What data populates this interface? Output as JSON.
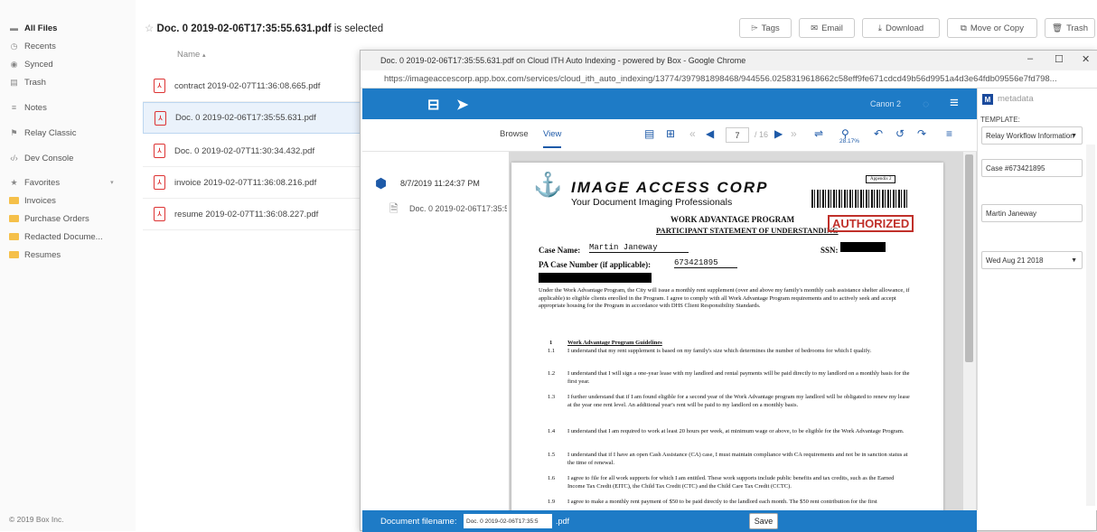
{
  "sidebar": {
    "items": [
      {
        "label": "All Files",
        "icon": "folder-icon"
      },
      {
        "label": "Recents",
        "icon": "clock-icon"
      },
      {
        "label": "Synced",
        "icon": "sync-icon"
      },
      {
        "label": "Trash",
        "icon": "trash-icon"
      },
      {
        "label": "Notes",
        "icon": "notes-icon"
      },
      {
        "label": "Relay Classic",
        "icon": "relay-icon"
      },
      {
        "label": "Dev Console",
        "icon": "code-icon"
      },
      {
        "label": "Favorites",
        "icon": "star-icon"
      },
      {
        "label": "Invoices",
        "icon": "folder-icon"
      },
      {
        "label": "Purchase Orders",
        "icon": "folder-icon"
      },
      {
        "label": "Redacted Docume...",
        "icon": "folder-icon"
      },
      {
        "label": "Resumes",
        "icon": "folder-icon"
      }
    ],
    "copyright": "© 2019 Box Inc."
  },
  "header": {
    "selected_name": "Doc. 0 2019-02-06T17:35:55.631.pdf",
    "selected_suffix": " is selected",
    "buttons": {
      "tags": "Tags",
      "email": "Email",
      "download": "Download",
      "move_copy": "Move or Copy",
      "trash": "Trash"
    }
  },
  "filelist": {
    "column_name": "Name",
    "files": [
      "contract 2019-02-07T11:36:08.665.pdf",
      "Doc. 0 2019-02-06T17:35:55.631.pdf",
      "Doc. 0 2019-02-07T11:30:34.432.pdf",
      "invoice 2019-02-07T11:36:08.216.pdf",
      "resume 2019-02-07T11:36:08.227.pdf"
    ]
  },
  "popup": {
    "window_title": "Doc. 0 2019-02-06T17:35:55.631.pdf on Cloud ITH Auto Indexing - powered by Box - Google Chrome",
    "url": "https://imageaccescorp.app.box.com/services/cloud_ith_auto_indexing/13774/397981898468/944556.0258319618662c58eff9fe671cdcd49b56d9951a4d3e64fdb09556e7fd798...",
    "app_profile": "Canon 2",
    "toolbar": {
      "browse": "Browse",
      "view": "View",
      "page_current": "7",
      "page_total": "/ 16",
      "zoom": "28.17%"
    },
    "left_panel": {
      "timestamp": "8/7/2019 11:24:37 PM",
      "doc_name": "Doc. 0 2019-02-06T17:35:55.631"
    },
    "document": {
      "logo": "IMAGE ACCESS CORP",
      "tagline": "Your Document Imaging Professionals",
      "appendix": "Appendix 2",
      "program_title": "WORK ADVANTAGE PROGRAM",
      "program_sub": "PARTICIPANT STATEMENT OF UNDERSTANDING",
      "stamp": "AUTHORIZED",
      "case_name_label": "Case Name:",
      "case_name_value": "Martin Janeway",
      "ssn_label": "SSN:",
      "pa_case_label": "PA Case Number (if applicable):",
      "pa_case_value": "673421895",
      "intro": "Under the Work Advantage Program, the City will issue a monthly rent supplement (over and above my family's monthly cash assistance shelter allowance, if applicable) to eligible clients enrolled in the Program. I agree to comply with all Work Advantage Program requirements and to actively seek and accept appropriate housing for the Program in accordance with DHS Client Responsibility Standards.",
      "section_num": "1",
      "section_title": "Work Advantage Program Guidelines",
      "items": [
        {
          "num": "1.1",
          "text": "I understand that my rent supplement is based on my family's size which determines the number of bedrooms for which I qualify."
        },
        {
          "num": "1.2",
          "text": "I understand that I will sign a one-year lease with my landlord and rental payments will be paid directly to my landlord on a monthly basis for the first year."
        },
        {
          "num": "1.3",
          "text": "I further understand that if I am found eligible for a second year of the Work Advantage program my landlord will be obligated to renew my lease at the year one rent level. An additional year's rent will be paid to my landlord on a monthly basis."
        },
        {
          "num": "1.4",
          "text": "I understand that I am required to work at least 20 hours per week, at minimum wage or above, to be eligible for the Work Advantage Program."
        },
        {
          "num": "1.5",
          "text": "I understand that if I have an open Cash Assistance (CA) case, I must maintain compliance with CA requirements and not be in sanction status at the time of renewal."
        },
        {
          "num": "1.6",
          "text": "I agree to file for all work supports for which I am entitled. These work supports include public benefits and tax credits, such as the Earned Income Tax Credit (EITC), the Child Tax Credit (CTC) and the Child Care Tax Credit (CCTC)."
        },
        {
          "num": "1.9",
          "text": "I agree to make a monthly rent payment of $50 to be paid directly to the landlord each month. The $50 rent contribution for the first"
        }
      ]
    },
    "metadata": {
      "title": "metadata",
      "template_label": "TEMPLATE:",
      "template_value": "Relay Workflow Information",
      "case_value": "Case #673421895",
      "name_value": "Martin Janeway",
      "date_value": "Wed Aug 21 2018"
    },
    "footer": {
      "filename_label": "Document filename:",
      "filename_value": "Doc. 0 2019-02-06T17:35:5",
      "ext": ".pdf",
      "save": "Save"
    }
  },
  "colors": {
    "brand_blue": "#1e7bc6",
    "stamp_red": "#c0302a",
    "folder_yellow": "#f5c04a"
  }
}
